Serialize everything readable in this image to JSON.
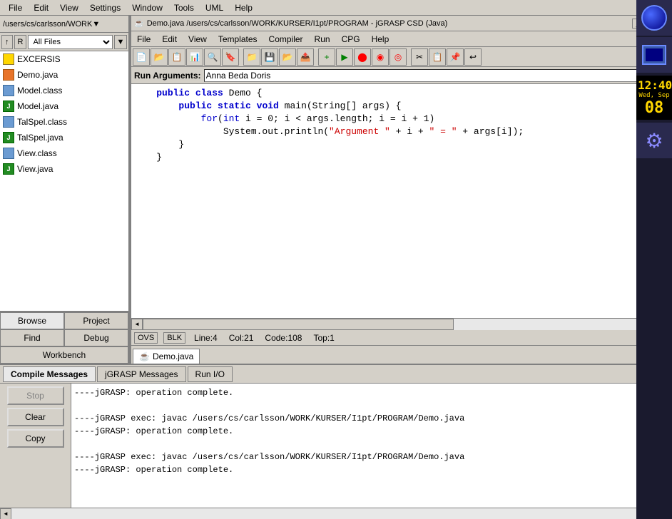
{
  "app": {
    "menu": [
      "File",
      "Edit",
      "View",
      "Templates",
      "Compiler",
      "Run",
      "CPG",
      "Help"
    ]
  },
  "topMenuBar": {
    "items": [
      "File",
      "Edit",
      "View",
      "Settings",
      "Window",
      "Tools",
      "UML",
      "Help"
    ]
  },
  "sidebar": {
    "path": "/users/cs/carlsson/WORK",
    "controls": {
      "up_btn": "↑",
      "r_btn": "R",
      "all_files": "All Files"
    },
    "files": [
      {
        "name": "EXCERSIS",
        "type": "folder"
      },
      {
        "name": "Demo.java",
        "type": "java"
      },
      {
        "name": "Model.class",
        "type": "class"
      },
      {
        "name": "Model.java",
        "type": "java_j"
      },
      {
        "name": "TalSpel.class",
        "type": "class"
      },
      {
        "name": "TalSpel.java",
        "type": "java_j"
      },
      {
        "name": "View.class",
        "type": "class"
      },
      {
        "name": "View.java",
        "type": "java_j"
      }
    ],
    "tabs": {
      "browse": "Browse",
      "project": "Project",
      "find": "Find",
      "debug": "Debug",
      "workbench": "Workbench"
    }
  },
  "editor": {
    "title": "Demo.java  /users/cs/carlsson/WORK/KURSER/I1pt/PROGRAM - jGRASP CSD (Java)",
    "win_btns": [
      "_",
      "□",
      "×"
    ],
    "menu": [
      "File",
      "Edit",
      "View",
      "Templates",
      "Compiler",
      "Run",
      "CPG",
      "Help"
    ],
    "run_args_label": "Run Arguments:",
    "run_args_value": "Anna Beda Doris",
    "code": [
      "    public class Demo {",
      "        public static void main(String[] args) {",
      "            for(int i = 0; i < args.length; i = i + 1)",
      "                System.out.println(\"Argument \" + i + \" = \" + args[i]);",
      "        }",
      "    }"
    ],
    "status": {
      "ovs": "OVS",
      "blk": "BLK",
      "line": "Line:4",
      "col": "Col:21",
      "code": "Code:108",
      "top": "Top:1"
    },
    "file_tab": "Demo.java"
  },
  "bottom": {
    "tabs": [
      "Compile Messages",
      "jGRASP Messages",
      "Run I/O"
    ],
    "active_tab": "Compile Messages",
    "buttons": {
      "stop": "Stop",
      "clear": "Clear",
      "copy": "Copy"
    },
    "output": [
      "----jGRASP: operation complete.",
      "",
      "----jGRASP exec: javac /users/cs/carlsson/WORK/KURSER/I1pt/PROGRAM/Demo.java",
      "----jGRASP: operation complete.",
      "",
      "----jGRASP exec: javac /users/cs/carlsson/WORK/KURSER/I1pt/PROGRAM/Demo.java",
      "----jGRASP: operation complete."
    ]
  },
  "clock": {
    "time": "12:40",
    "day_label": "Wed, Sep",
    "day_num": "08"
  },
  "toolbar": {
    "buttons": [
      "✦",
      "📄",
      "📋",
      "📊",
      "🔍",
      "🔖",
      "📁",
      "💾",
      "📂",
      "📤",
      "+",
      "▶",
      "⬤",
      "◉",
      "◎",
      "✂",
      "📋",
      "📌",
      "↩"
    ]
  }
}
